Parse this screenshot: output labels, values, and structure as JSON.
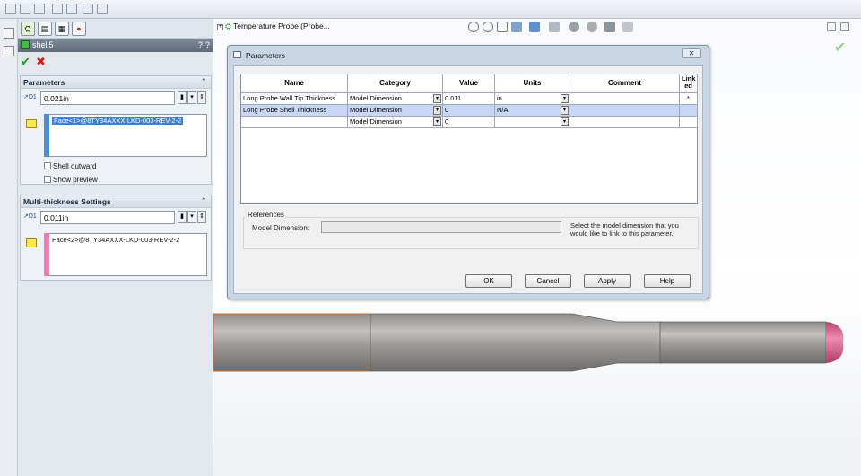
{
  "feature": {
    "name": "shell5",
    "help_label": "?·?"
  },
  "parameters_group": {
    "title": "Parameters",
    "thickness_value": "0.021in",
    "faces": [
      "Face<1>@8TY34AXXX-LKD-003-REV-2-2"
    ],
    "shell_outward_label": "Shell outward",
    "show_preview_label": "Show preview",
    "list_color": "#4a90d9"
  },
  "multi_group": {
    "title": "Multi-thickness Settings",
    "thickness_value": "0.011in",
    "faces": [
      "Face<2>@8TY34AXXX-LKD-003-REV-2-2"
    ],
    "list_color": "#f07ab4"
  },
  "graphics": {
    "tree_root_label": "Temperature Probe  (Probe..."
  },
  "dialog": {
    "title": "Parameters",
    "columns": [
      "Name",
      "Category",
      "Value",
      "Units",
      "Comment",
      "Link ed"
    ],
    "rows": [
      {
        "name": "Long Probe Wall Tip Thickness",
        "category": "Model Dimension",
        "value": "0.011",
        "units": "in",
        "comment": "",
        "linked": "*"
      },
      {
        "name": "Long Probe Shell Thickness",
        "category": "Model Dimension",
        "value": "0",
        "units": "N/A",
        "comment": "",
        "linked": ""
      },
      {
        "name": "",
        "category": "Model Dimension",
        "value": "0",
        "units": "",
        "comment": "",
        "linked": ""
      }
    ],
    "references_label": "References",
    "model_dimension_label": "Model Dimension:",
    "hint_text": "Select the model dimension that you would like to link to this parameter.",
    "buttons": {
      "ok": "OK",
      "cancel": "Cancel",
      "apply": "Apply",
      "help": "Help"
    },
    "selected_row_color": "#c7d7f5"
  }
}
